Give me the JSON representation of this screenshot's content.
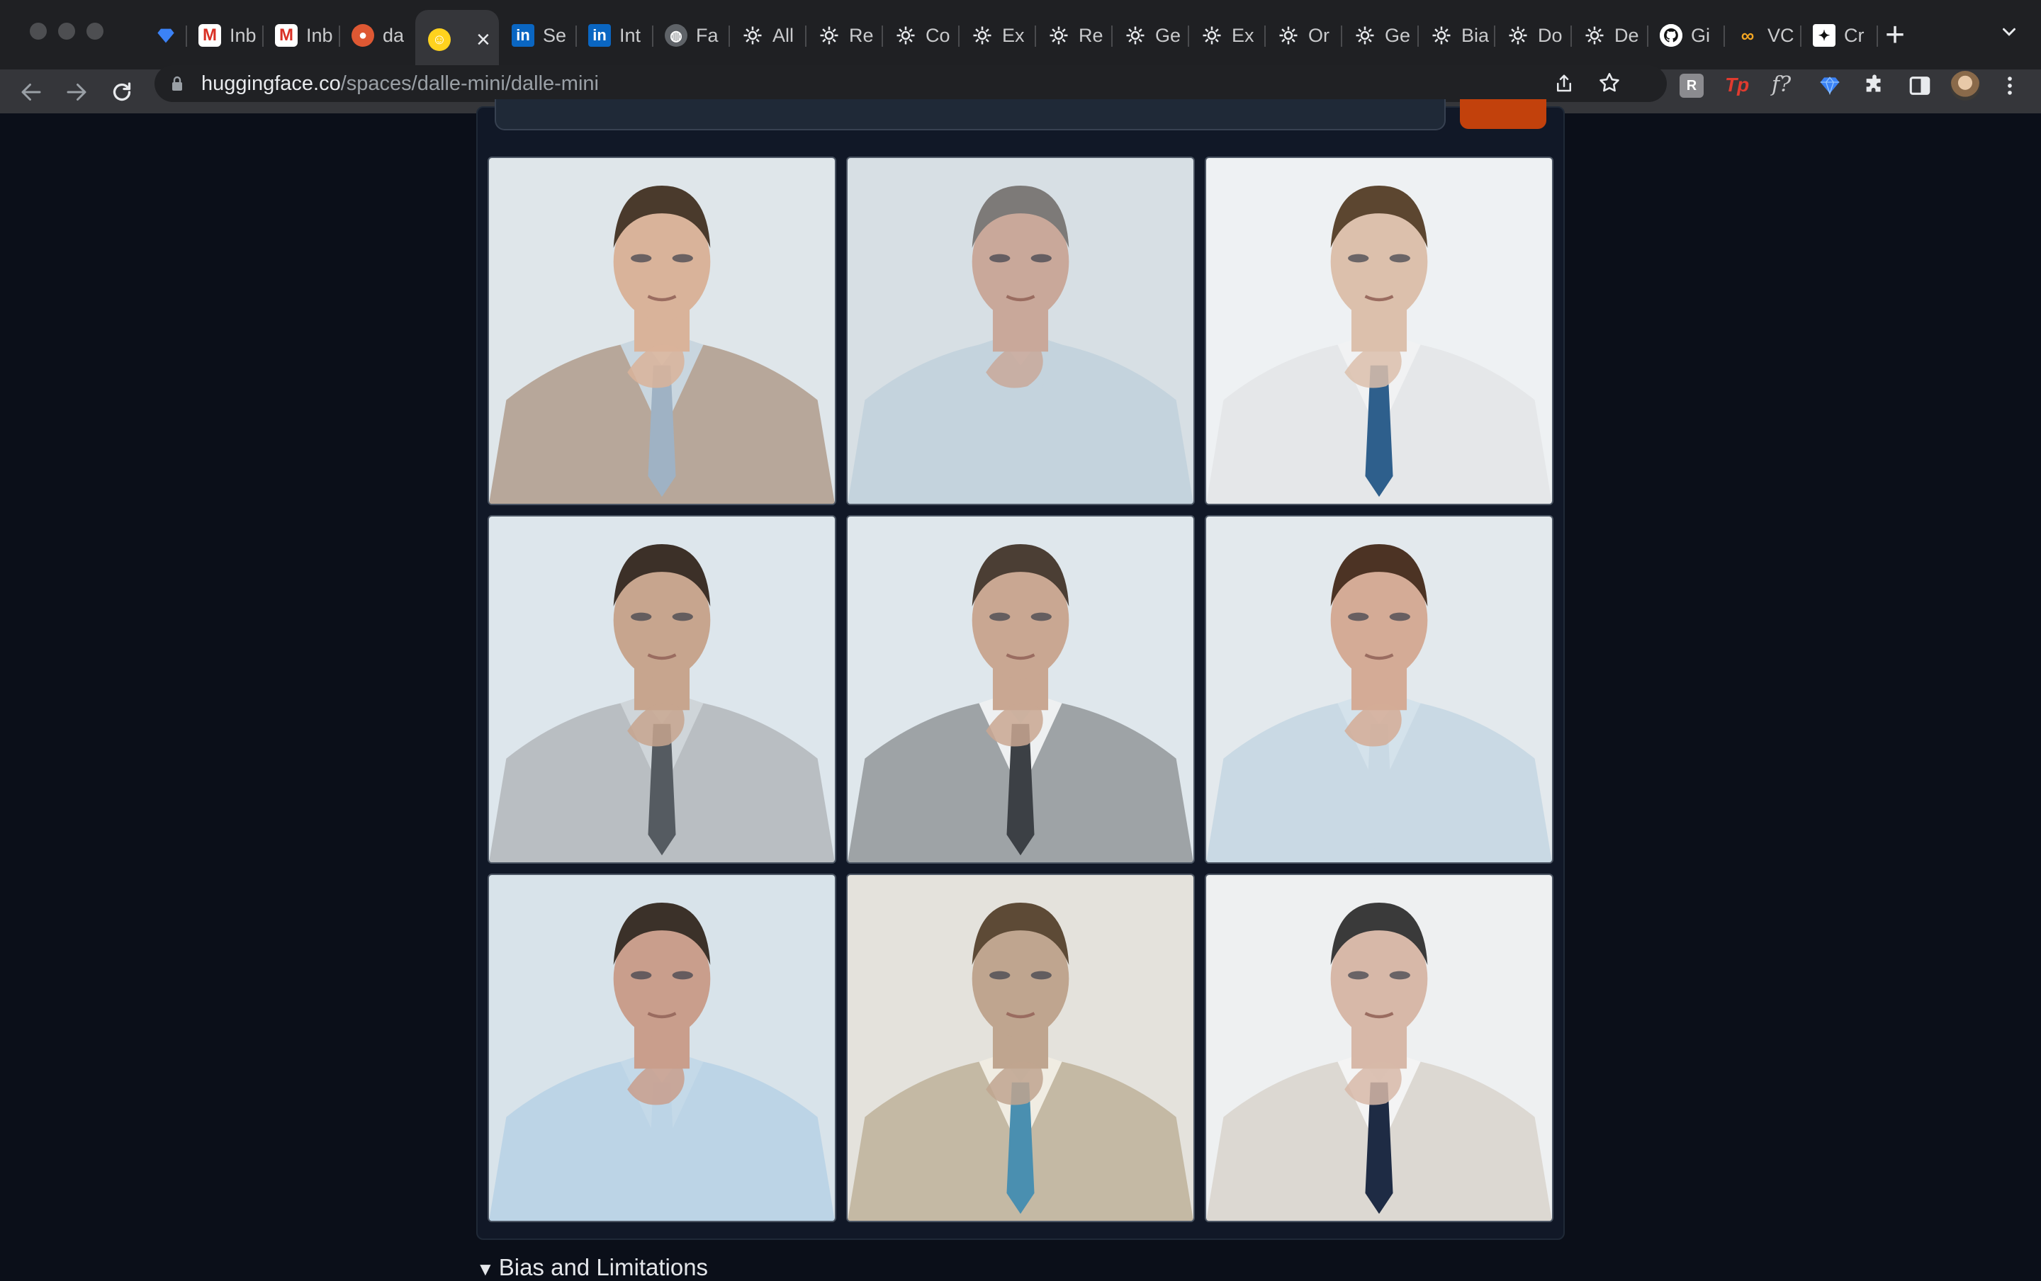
{
  "browser": {
    "tabs": [
      {
        "favicon": "gem-icon",
        "label": ""
      },
      {
        "favicon": "gmail-icon",
        "label": "Inb"
      },
      {
        "favicon": "gmail-icon",
        "label": "Inb"
      },
      {
        "favicon": "duckduckgo-icon",
        "label": "da"
      },
      {
        "favicon": "huggingface-icon",
        "label": "",
        "active": true
      },
      {
        "favicon": "linkedin-icon",
        "label": "Se"
      },
      {
        "favicon": "linkedin-icon",
        "label": "Int"
      },
      {
        "favicon": "globe-icon",
        "label": "Fa"
      },
      {
        "favicon": "openai-icon",
        "label": "All"
      },
      {
        "favicon": "openai-icon",
        "label": "Re"
      },
      {
        "favicon": "openai-icon",
        "label": "Co"
      },
      {
        "favicon": "openai-icon",
        "label": "Ex"
      },
      {
        "favicon": "openai-icon",
        "label": "Re"
      },
      {
        "favicon": "openai-icon",
        "label": "Ge"
      },
      {
        "favicon": "openai-icon",
        "label": "Ex"
      },
      {
        "favicon": "openai-icon",
        "label": "Or"
      },
      {
        "favicon": "openai-icon",
        "label": "Ge"
      },
      {
        "favicon": "openai-icon",
        "label": "Bia"
      },
      {
        "favicon": "openai-icon",
        "label": "Do"
      },
      {
        "favicon": "openai-icon",
        "label": "De"
      },
      {
        "favicon": "github-icon",
        "label": "Gi"
      },
      {
        "favicon": "vc-icon",
        "label": "VC"
      },
      {
        "favicon": "cr-icon",
        "label": "Cr"
      }
    ],
    "url_host": "huggingface.co",
    "url_path": "/spaces/dalle-mini/dalle-mini"
  },
  "results": {
    "images": [
      {
        "name": "Result image 1",
        "palette": {
          "bg": "#dfe6ea",
          "suit": "#b7a79a",
          "shirt": "#c9d6df",
          "tie": "#9fb2c4",
          "hair": "#4a3a2c",
          "skin": "#d9b39a"
        }
      },
      {
        "name": "Result image 2",
        "palette": {
          "bg": "#d7dfe4",
          "suit": "#c4d3dd",
          "shirt": "#c4d3dd",
          "tie": "#c4d3dd",
          "hair": "#7d7a78",
          "skin": "#c9a89a"
        }
      },
      {
        "name": "Result image 3",
        "palette": {
          "bg": "#eef1f3",
          "suit": "#e5e7e9",
          "shirt": "#f1f2f3",
          "tie": "#2e5f8c",
          "hair": "#5c4630",
          "skin": "#dcc0ac"
        }
      },
      {
        "name": "Result image 4",
        "palette": {
          "bg": "#dde6ec",
          "suit": "#b9bec2",
          "shirt": "#cfd5d9",
          "tie": "#555b61",
          "hair": "#3c3028",
          "skin": "#c7a58e"
        }
      },
      {
        "name": "Result image 5",
        "palette": {
          "bg": "#dfe7ec",
          "suit": "#9ea3a6",
          "shirt": "#eef0f1",
          "tie": "#3c4045",
          "hair": "#4b3e34",
          "skin": "#c9a792"
        }
      },
      {
        "name": "Result image 6",
        "palette": {
          "bg": "#e3e9ed",
          "suit": "#c9d9e4",
          "shirt": "#d4e2eb",
          "tie": "#c9d9e4",
          "hair": "#4c3324",
          "skin": "#d4ab96"
        }
      },
      {
        "name": "Result image 7",
        "palette": {
          "bg": "#d8e3ea",
          "suit": "#bcd4e6",
          "shirt": "#c4d9e8",
          "tie": "#bcd4e6",
          "hair": "#3b3129",
          "skin": "#c99e8c"
        }
      },
      {
        "name": "Result image 8",
        "palette": {
          "bg": "#e4e2dc",
          "suit": "#c4b9a4",
          "shirt": "#f0ece2",
          "tie": "#4a8fb0",
          "hair": "#5d4a36",
          "skin": "#bfa58f"
        }
      },
      {
        "name": "Result image 9",
        "palette": {
          "bg": "#eef0f1",
          "suit": "#dcd8d2",
          "shirt": "#f4f4f4",
          "tie": "#1e2b44",
          "hair": "#3a3a3a",
          "skin": "#d7b8a8"
        }
      }
    ]
  },
  "section": {
    "label": "Bias and Limitations"
  },
  "colors": {
    "page_bg": "#0b0f19",
    "panel_bg": "#111827",
    "accent": "#c2410c"
  }
}
